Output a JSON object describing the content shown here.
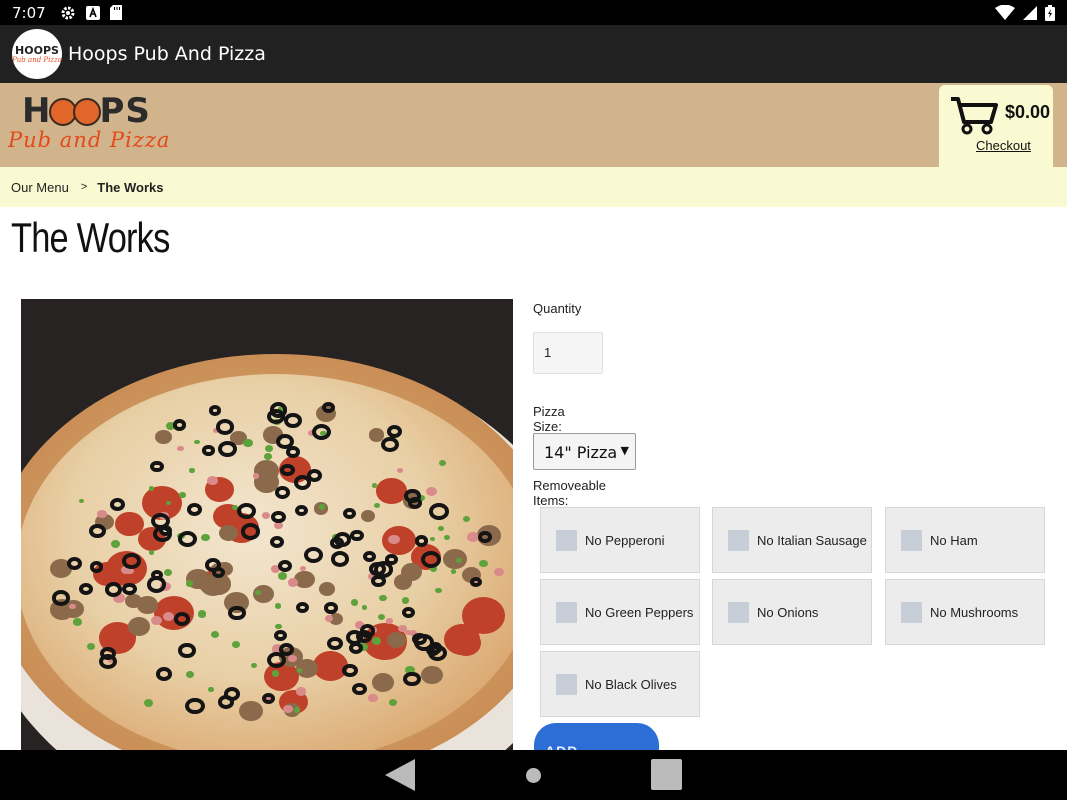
{
  "status": {
    "time": "7:07"
  },
  "appbar": {
    "title": "Hoops Pub And Pizza",
    "logo_top": "HOOPS",
    "logo_bottom": "Pub and Pizza"
  },
  "brand": {
    "line1_a": "H",
    "line1_b": "PS",
    "line2": "Pub and Pizza"
  },
  "cart": {
    "total": "$0.00",
    "checkout": "Checkout"
  },
  "breadcrumb": {
    "parent": "Our Menu",
    "sep": ">",
    "current": "The Works"
  },
  "page": {
    "title": "The Works"
  },
  "form": {
    "quantity_label": "Quantity",
    "quantity_value": "1",
    "size_label": "Pizza Size:",
    "size_value": "14\" Pizza",
    "removeable_label": "Removeable Items:",
    "options": [
      "No Pepperoni",
      "No Italian Sausage",
      "No Ham",
      "No Green Peppers",
      "No Onions",
      "No Mushrooms",
      "No Black Olives"
    ]
  },
  "add_button": "ADD PRODUCT"
}
